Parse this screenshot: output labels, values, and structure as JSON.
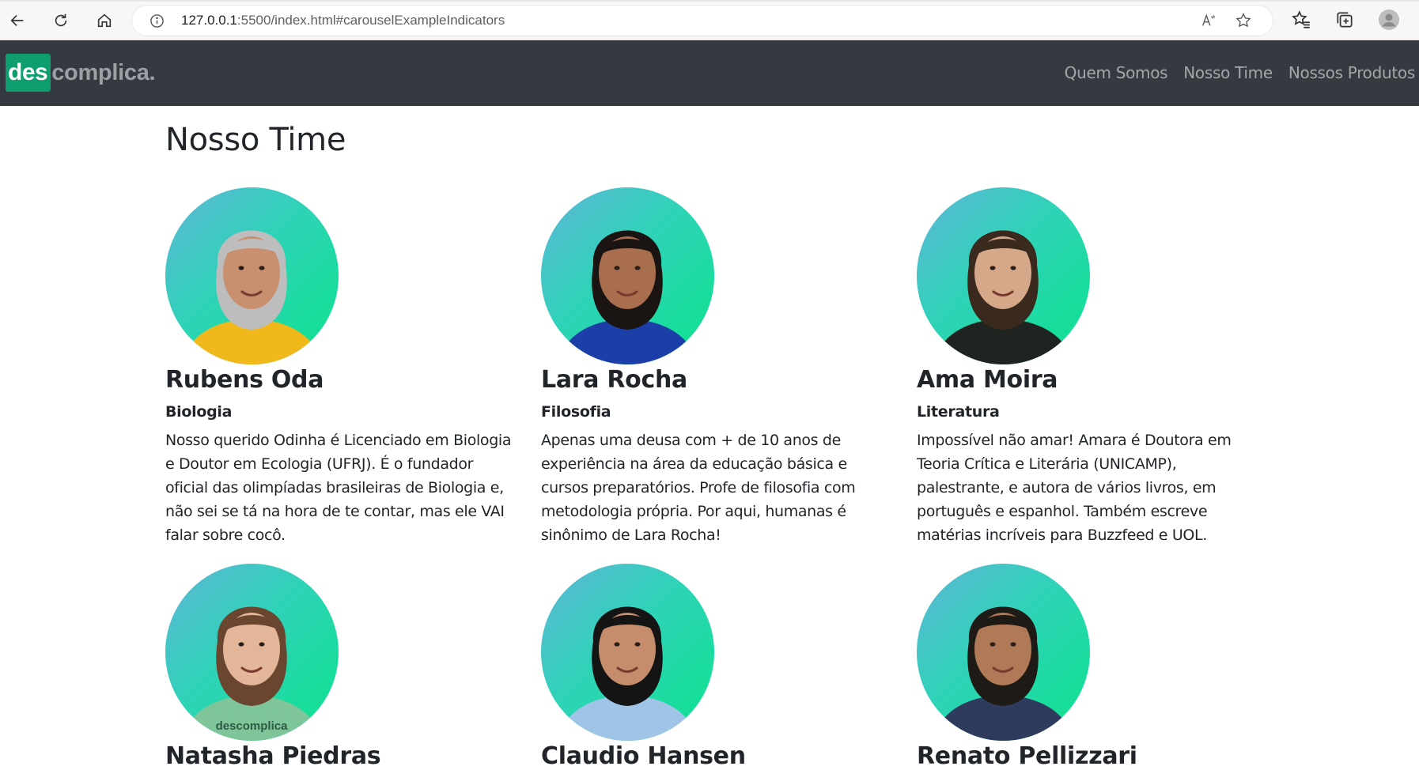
{
  "browser": {
    "url_host": "127.0.0.1",
    "url_rest": ":5500/index.html#carouselExampleIndicators",
    "icons": [
      "back-icon",
      "reload-icon",
      "home-icon",
      "info-icon",
      "read-aloud-icon",
      "favorite-star-icon",
      "favorites-icon",
      "collections-icon",
      "profile-icon"
    ]
  },
  "navbar": {
    "logo_box": "des",
    "logo_rest": "complica.",
    "links": [
      "Quem Somos",
      "Nosso Time",
      "Nossos Produtos"
    ]
  },
  "page": {
    "title": "Nosso Time"
  },
  "team": [
    {
      "name": "Rubens Oda",
      "subject": "Biologia",
      "bio": "Nosso querido Odinha é Licenciado em Biologia e Doutor em Ecologia (UFRJ). É o fundador oficial das olimpíadas brasileiras de Biologia e, não sei se tá na hora de te contar, mas ele VAI falar sobre cocô.",
      "shirt_color": "#f1b81c",
      "skin_color": "#c99070",
      "hair_color": "#bdbdbd"
    },
    {
      "name": "Lara Rocha",
      "subject": "Filosofia",
      "bio": "Apenas uma deusa com + de 10 anos de experiência na área da educação básica e cursos preparatórios. Profe de filosofia com metodologia própria. Por aqui, humanas é sinônimo de Lara Rocha!",
      "shirt_color": "#1b3ea8",
      "skin_color": "#a86e4d",
      "hair_color": "#1a1412"
    },
    {
      "name": "Ama Moira",
      "subject": "Literatura",
      "bio": "Impossível não amar! Amara é Doutora em Teoria Crítica e Literária (UNICAMP), palestrante, e autora de vários livros, em português e espanhol. Também escreve matérias incríveis para Buzzfeed e UOL.",
      "shirt_color": "#1f2420",
      "skin_color": "#d6a88a",
      "hair_color": "#3a2a1e"
    },
    {
      "name": "Natasha Piedras",
      "subject": "",
      "bio": "",
      "shirt_color": "#7fc59a",
      "skin_color": "#e4b699",
      "hair_color": "#6a4630",
      "shirt_text": "descomplica"
    },
    {
      "name": "Claudio Hansen",
      "subject": "",
      "bio": "",
      "shirt_color": "#9fc4e6",
      "skin_color": "#c58d6c",
      "hair_color": "#141414"
    },
    {
      "name": "Renato Pellizzari",
      "subject": "",
      "bio": "",
      "shirt_color": "#2f3b5c",
      "skin_color": "#b07a58",
      "hair_color": "#1e1a16"
    }
  ]
}
